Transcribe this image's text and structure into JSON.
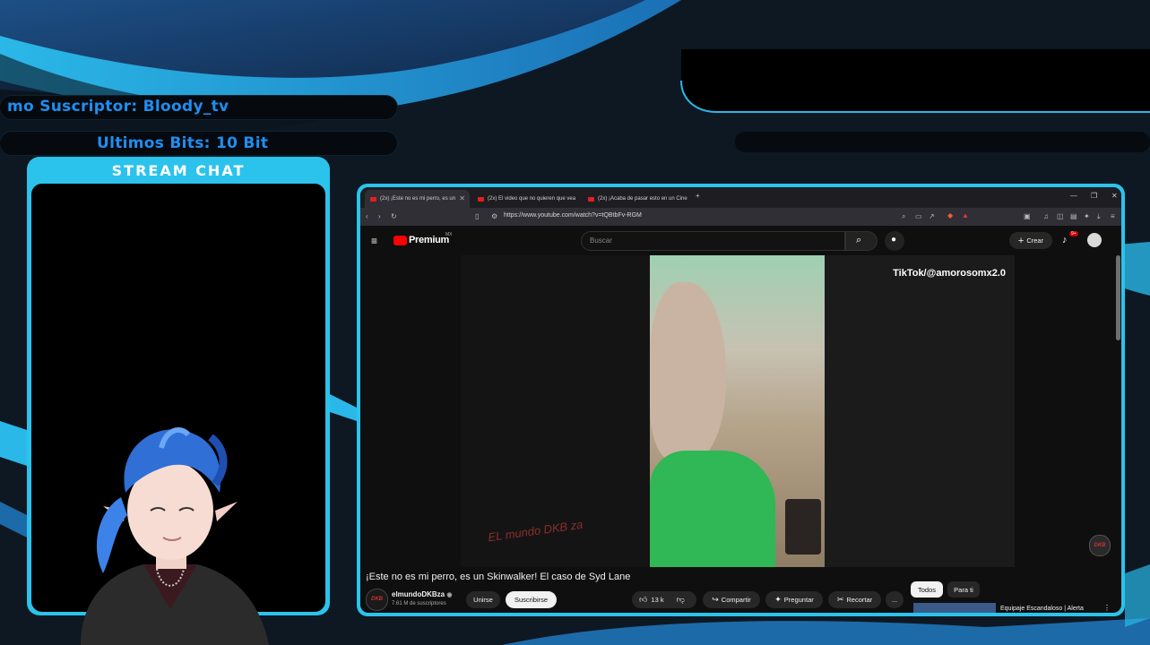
{
  "overlay": {
    "last_sub": "mo Suscriptor: Bloody_tv",
    "last_bits": "Ultimos Bits: 10 Bit",
    "chat_title": "STREAM CHAT",
    "accent_color": "#2bc3ec"
  },
  "browser": {
    "tabs": [
      {
        "label": "(2x) ¡Este no es mi perro, es un",
        "active": true
      },
      {
        "label": "(2x) El video que no quieren que vea",
        "active": false
      },
      {
        "label": "(2x) ¡Acaba de pasar esto en un Cine",
        "active": false
      }
    ],
    "new_tab": "+",
    "url": "https://www.youtube.com/watch?v=tQBtbFv-RGM"
  },
  "youtube": {
    "logo": "Premium",
    "logo_region": "MX",
    "search_placeholder": "Buscar",
    "create_label": "Crear",
    "notifications_badge": "9+",
    "video_watermark": "TikTok/@amorosomx2.0",
    "channel_watermark": "EL mundo DKB za",
    "corner_logo": "DKB",
    "video_title": "¡Este no es mi perro, es un Skinwalker! El caso de Syd Lane",
    "channel_name": "elmundoDKBza",
    "channel_avatar": "DKB",
    "subscribers": "7.61 M de suscriptores",
    "join_label": "Unirse",
    "subscribe_label": "Suscribirse",
    "likes": "13 k",
    "share_label": "Compartir",
    "ask_label": "Preguntar",
    "clip_label": "Recortar",
    "more_label": "...",
    "chips": [
      "Todos",
      "Para ti"
    ],
    "rec_title": "Equipaje Escandaloso | Alerta"
  }
}
